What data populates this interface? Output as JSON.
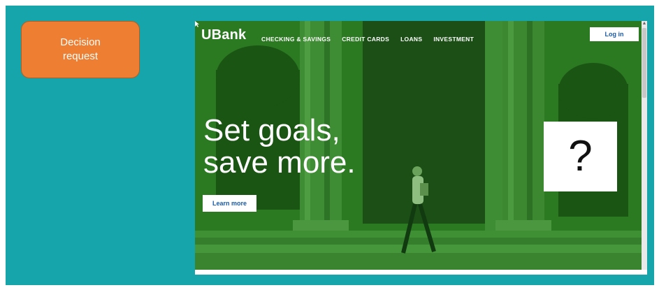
{
  "decision_box": {
    "label": "Decision\nrequest"
  },
  "site": {
    "logo": "UBank",
    "nav": [
      "CHECKING & SAVINGS",
      "CREDIT CARDS",
      "LOANS",
      "INVESTMENT"
    ],
    "login_label": "Log in",
    "headline": "Set goals,\nsave more.",
    "cta_label": "Learn more"
  },
  "question_box": {
    "symbol": "?"
  },
  "icons": {
    "scroll_up": "scroll-up-icon",
    "cursor": "mouse-cursor-icon"
  },
  "colors": {
    "background": "#16a5ab",
    "decision_box": "#ee7e32",
    "hero_tint": "#1e6b1a",
    "link": "#1a5aa8"
  }
}
